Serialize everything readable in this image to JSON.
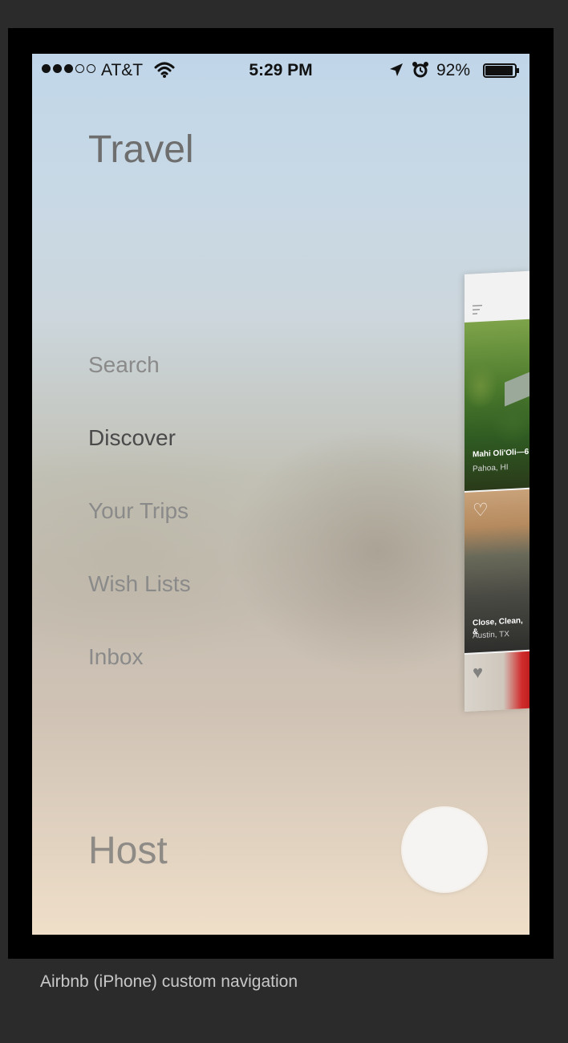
{
  "status_bar": {
    "carrier": "AT&T",
    "time": "5:29 PM",
    "battery_percent": "92%",
    "signal_bars_filled": 3,
    "signal_bars_total": 5,
    "icons": [
      "signal-dots-icon",
      "wifi-icon",
      "location-arrow-icon",
      "alarm-clock-icon",
      "battery-icon"
    ]
  },
  "menu": {
    "title": "Travel",
    "items": [
      {
        "label": "Search",
        "active": false
      },
      {
        "label": "Discover",
        "active": true
      },
      {
        "label": "Your Trips",
        "active": false
      },
      {
        "label": "Wish Lists",
        "active": false
      },
      {
        "label": "Inbox",
        "active": false
      }
    ],
    "host_label": "Host"
  },
  "peek_app": {
    "listings": [
      {
        "title": "Mahi Oli'Oli—6",
        "location": "Pahoa, HI"
      },
      {
        "title": "Close, Clean, &",
        "location": "Austin, TX"
      }
    ]
  },
  "caption": "Airbnb (iPhone) custom navigation",
  "colors": {
    "page_background": "#2b2b2b",
    "frame": "#000000",
    "menu_text": "#8a8a8a",
    "menu_text_active": "#4a4a4a"
  }
}
